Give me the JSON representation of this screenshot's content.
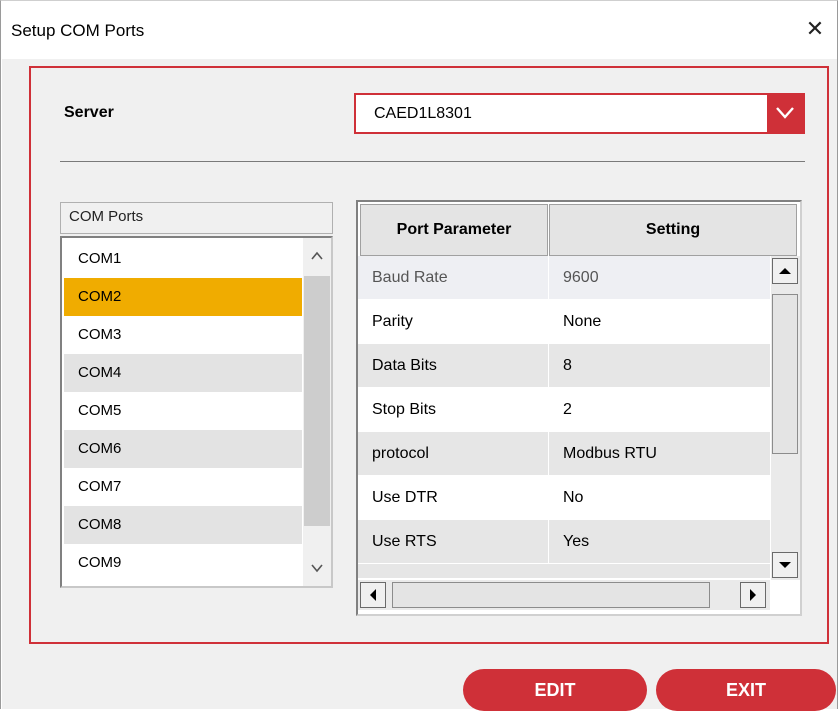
{
  "window": {
    "title": "Setup COM Ports",
    "close_glyph": "✕"
  },
  "server": {
    "label": "Server",
    "value": "CAED1L8301"
  },
  "com_ports": {
    "header": "COM Ports",
    "items": [
      "COM1",
      "COM2",
      "COM3",
      "COM4",
      "COM5",
      "COM6",
      "COM7",
      "COM8",
      "COM9"
    ],
    "selected": "COM2"
  },
  "grid": {
    "columns": [
      "Port Parameter",
      "Setting"
    ],
    "rows": [
      {
        "param": "Baud Rate",
        "setting": "9600"
      },
      {
        "param": "Parity",
        "setting": "None"
      },
      {
        "param": "Data Bits",
        "setting": "8"
      },
      {
        "param": "Stop Bits",
        "setting": "2"
      },
      {
        "param": "protocol",
        "setting": "Modbus RTU"
      },
      {
        "param": "Use DTR",
        "setting": "No"
      },
      {
        "param": "Use RTS",
        "setting": "Yes"
      }
    ]
  },
  "buttons": {
    "edit": "EDIT",
    "exit": "EXIT"
  },
  "colors": {
    "accent": "#cf3038",
    "selection": "#f0ac00",
    "alt_row": "#e3e3e3",
    "dialog_bg": "#f0f0f0"
  },
  "icons": {
    "close": "close-icon",
    "combo_arrow": "chevron-down-icon"
  }
}
